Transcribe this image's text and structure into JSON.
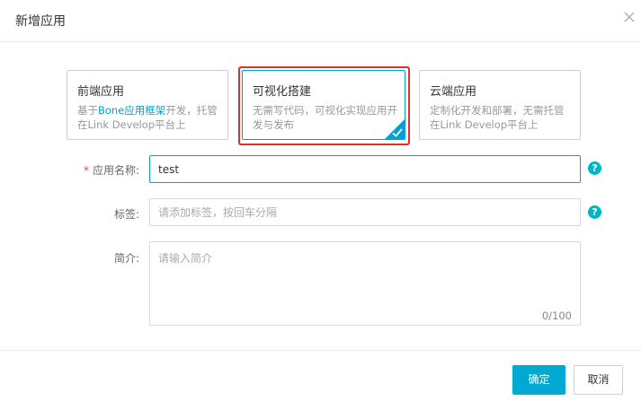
{
  "dialog": {
    "title": "新增应用",
    "close_icon": "close-icon"
  },
  "cards": [
    {
      "title": "前端应用",
      "desc_prefix": "基于",
      "desc_highlight": "Bone应用框架",
      "desc_suffix": "开发，托管在Link Develop平台上",
      "selected": false
    },
    {
      "title": "可视化搭建",
      "desc": "无需写代码，可视化实现应用开发与发布",
      "selected": true
    },
    {
      "title": "云端应用",
      "desc": "定制化开发和部署，无需托管在Link Develop平台上",
      "selected": false
    }
  ],
  "form": {
    "name": {
      "required_mark": "*",
      "label": "应用名称:",
      "value": "test"
    },
    "tags": {
      "label": "标签:",
      "placeholder": "请添加标签，按回车分隔"
    },
    "intro": {
      "label": "简介:",
      "placeholder": "请输入简介",
      "counter": "0/100"
    },
    "help_glyph": "?"
  },
  "footer": {
    "ok_label": "确定",
    "cancel_label": "取消"
  },
  "colors": {
    "accent": "#00a1d6",
    "primary_button": "#00a9d1",
    "highlight_frame": "#e0302a",
    "help_icon": "#00b5c6"
  }
}
